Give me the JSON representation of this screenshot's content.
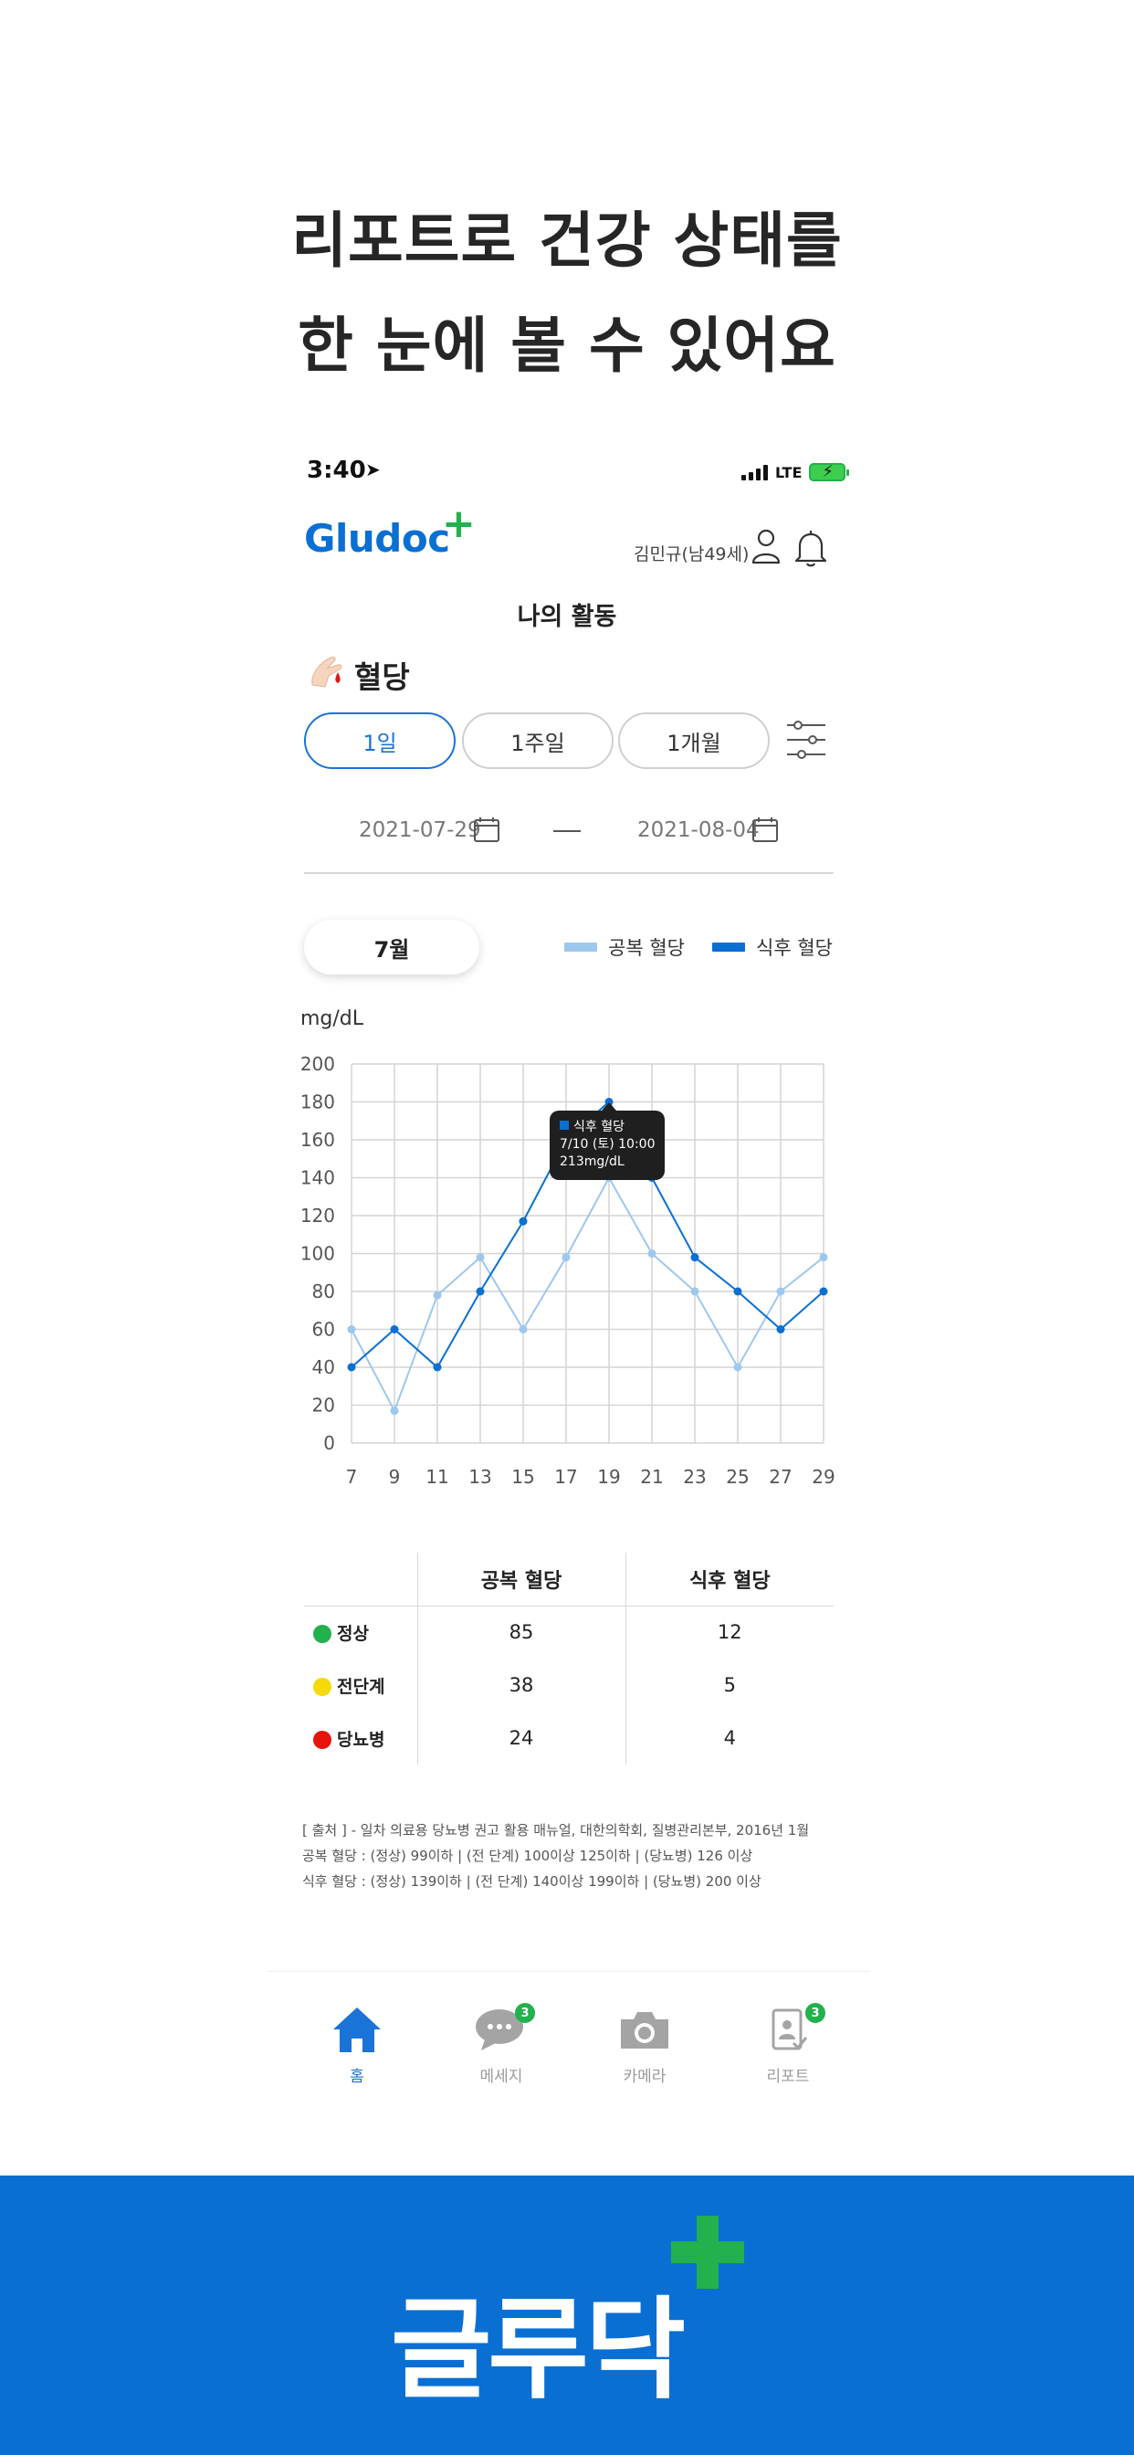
{
  "headline": {
    "line1": "리포트로 건강 상태를",
    "line2": "한 눈에 볼 수 있어요"
  },
  "status_bar": {
    "time": "3:40",
    "network": "LTE"
  },
  "header": {
    "logo": "Gludoc",
    "logo_plus": "+",
    "user": "김민규(남49세)"
  },
  "page": {
    "title": "나의 활동",
    "section": "혈당"
  },
  "period_tabs": [
    {
      "label": "1일",
      "active": true
    },
    {
      "label": "1주일",
      "active": false
    },
    {
      "label": "1개월",
      "active": false
    }
  ],
  "date_range": {
    "start": "2021-07-29",
    "end": "2021-08-04"
  },
  "month": "7월",
  "legend": {
    "fasting": "공복 혈당",
    "post_meal": "식후 혈당"
  },
  "colors": {
    "fasting": "#9cc8ee",
    "post_meal": "#0a6fd2",
    "accent": "#1a73d6",
    "brand_green": "#22b14c",
    "normal": "#22b14c",
    "pre": "#f5d90a",
    "diabetes": "#e8140c"
  },
  "chart_data": {
    "type": "line",
    "ylabel": "mg/dL",
    "ylim": [
      0,
      200
    ],
    "yticks": [
      0,
      20,
      40,
      60,
      80,
      100,
      120,
      140,
      160,
      180,
      200
    ],
    "xticks": [
      7,
      9,
      11,
      13,
      15,
      17,
      19,
      21,
      23,
      25,
      27,
      29
    ],
    "grid": true,
    "series": [
      {
        "name": "공복 혈당",
        "x": [
          7,
          9,
          11,
          13,
          15,
          17,
          19,
          21,
          23,
          25,
          27,
          29
        ],
        "values": [
          60,
          17,
          78,
          98,
          60,
          98,
          140,
          100,
          80,
          40,
          80,
          98
        ]
      },
      {
        "name": "식후 혈당",
        "x": [
          7,
          9,
          11,
          13,
          15,
          17,
          19,
          21,
          23,
          25,
          27,
          29
        ],
        "values": [
          40,
          60,
          40,
          80,
          117,
          160,
          180,
          140,
          98,
          80,
          60,
          80
        ]
      }
    ],
    "tooltip": {
      "title": "식후 혈당",
      "date": "7/10 (토) 10:00",
      "value": "213mg/dL"
    }
  },
  "stats": {
    "headers": [
      "",
      "공복 혈당",
      "식후 혈당"
    ],
    "rows": [
      {
        "label": "정상",
        "color": "#22b14c",
        "fasting": "85",
        "post_meal": "12"
      },
      {
        "label": "전단계",
        "color": "#f5d90a",
        "fasting": "38",
        "post_meal": "5"
      },
      {
        "label": "당뇨병",
        "color": "#e8140c",
        "fasting": "24",
        "post_meal": "4"
      }
    ]
  },
  "source_note": [
    "[ 출처 ] - 일차 의료용 당뇨병 권고 활용 매뉴얼, 대한의학회, 질병관리본부, 2016년 1월",
    "공복 혈당 : (정상) 99이하 | (전 단계) 100이상 125이하 | (당뇨병) 126 이상",
    "식후 혈당 : (정상) 139이하 | (전 단계) 140이상 199이하 | (당뇨병) 200 이상"
  ],
  "nav": [
    {
      "label": "홈",
      "icon": "home-icon",
      "active": true,
      "badge": ""
    },
    {
      "label": "메세지",
      "icon": "chat-icon",
      "active": false,
      "badge": "3"
    },
    {
      "label": "카메라",
      "icon": "camera-icon",
      "active": false,
      "badge": ""
    },
    {
      "label": "리포트",
      "icon": "report-icon",
      "active": false,
      "badge": "3"
    }
  ],
  "footer": {
    "brand": "글루닥"
  }
}
